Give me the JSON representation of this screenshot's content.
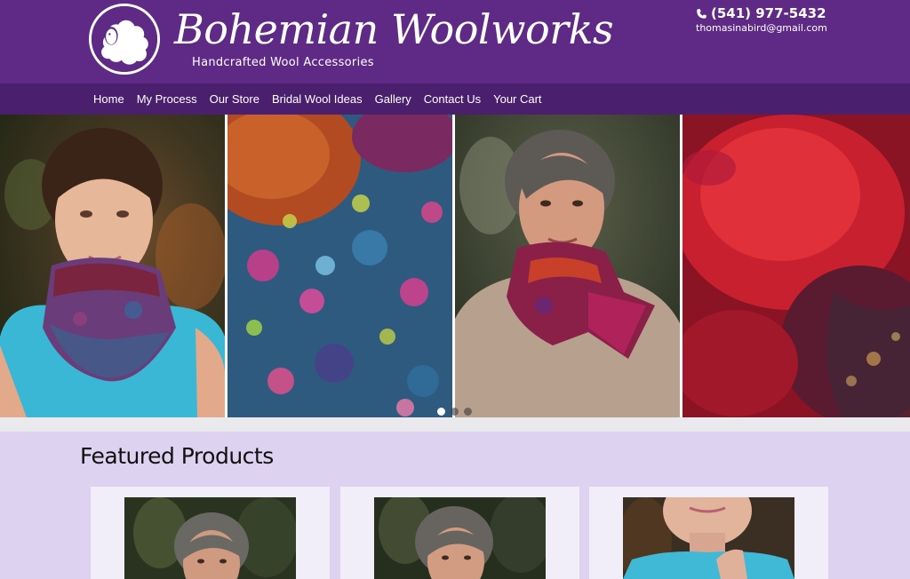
{
  "brand": {
    "name": "Bohemian Woolworks",
    "tagline": "Handcrafted Wool Accessories",
    "logo_icon": "sheep-logo-icon"
  },
  "contact": {
    "phone": "(541) 977-5432",
    "email": "thomasinabird@gmail.com",
    "phone_icon": "phone-icon"
  },
  "nav": {
    "items": [
      {
        "label": "Home"
      },
      {
        "label": "My Process"
      },
      {
        "label": "Our Store"
      },
      {
        "label": "Bridal Wool Ideas"
      },
      {
        "label": "Gallery"
      },
      {
        "label": "Contact Us"
      },
      {
        "label": "Your Cart"
      }
    ]
  },
  "slider": {
    "slides": [
      {
        "name": "girl-wearing-felted-cowl"
      },
      {
        "name": "blue-pink-felt-texture"
      },
      {
        "name": "woman-wearing-felted-scarf"
      },
      {
        "name": "red-felt-texture"
      }
    ],
    "dot_count": 3,
    "active_dot": 0
  },
  "featured": {
    "title": "Featured Products",
    "cards": [
      {
        "image": "woman-in-scarf-product-photo"
      },
      {
        "image": "woman-in-scarf-product-photo"
      },
      {
        "image": "girl-in-cowl-product-photo"
      }
    ]
  },
  "colors": {
    "header_bg": "#5e2a86",
    "nav_bg": "#4a1f6e",
    "featured_bg": "#ddd3f1",
    "card_bg": "#f1eef9"
  }
}
